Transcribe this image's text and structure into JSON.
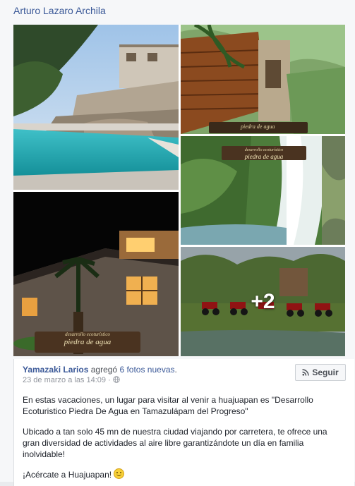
{
  "author": "Arturo Lazaro Archila",
  "post": {
    "poster_name": "Yamazaki Larios",
    "action_text": "agregó",
    "photos_text": "6 fotos nuevas",
    "period": ".",
    "timestamp": "23 de marzo a las 14:09 · ",
    "follow_label": "Seguir",
    "paragraph1": "En estas vacaciones, un lugar para visitar al venir a huajuapan es \"Desarrollo Ecoturistico Piedra De Agua en Tamazulápam del Progreso\"",
    "paragraph2": "Ubicado a tan solo 45 mn de nuestra ciudad viajando por carretera, te ofrece una gran diversidad de actividades al aire libre garantizándote un día en familia inolvidable!",
    "paragraph3": "¡Acércate a Huajuapan!"
  },
  "photos": {
    "more_count": "+2",
    "watermark": "piedra de agua",
    "watermark_small": "desarrollo ecoturístico"
  },
  "icons": {
    "follow": "rss-icon",
    "privacy": "globe-icon",
    "emoji": "smile-emoji-icon"
  }
}
